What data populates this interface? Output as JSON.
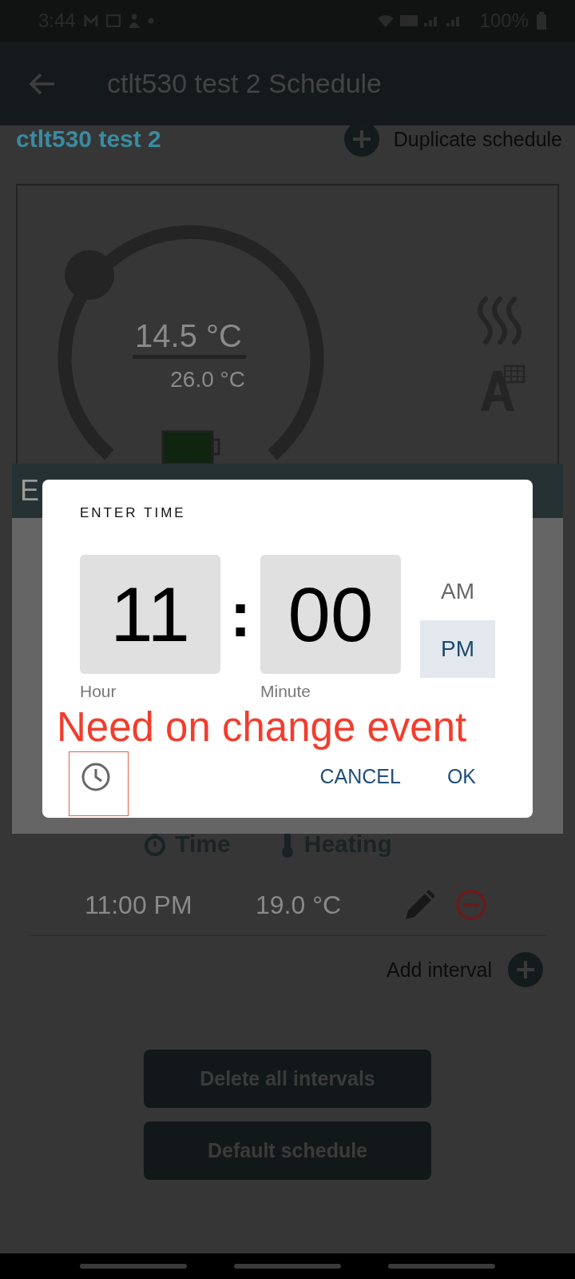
{
  "status_bar": {
    "time": "3:44",
    "battery": "100%"
  },
  "app_bar": {
    "title": "ctlt530 test 2 Schedule"
  },
  "schedule": {
    "name": "ctlt530 test 2",
    "duplicate_label": "Duplicate schedule"
  },
  "thermostat": {
    "current": "14.5 °C",
    "target": "26.0 °C"
  },
  "edit_panel": {
    "title": "E"
  },
  "time_dialog": {
    "title": "ENTER TIME",
    "hour": "11",
    "separator": ":",
    "minute": "00",
    "hour_label": "Hour",
    "minute_label": "Minute",
    "periods": [
      {
        "label": "AM",
        "selected": false
      },
      {
        "label": "PM",
        "selected": true
      }
    ],
    "buttons": [
      "CANCEL",
      "OK"
    ]
  },
  "annotation": {
    "text": "Need on change event"
  },
  "intervals": {
    "columns": [
      "Time",
      "Heating"
    ],
    "rows": [
      {
        "time": "11:00 PM",
        "temp": "19.0 °C"
      }
    ],
    "add_label": "Add interval"
  },
  "actions": [
    "Delete all intervals",
    "Default schedule"
  ]
}
